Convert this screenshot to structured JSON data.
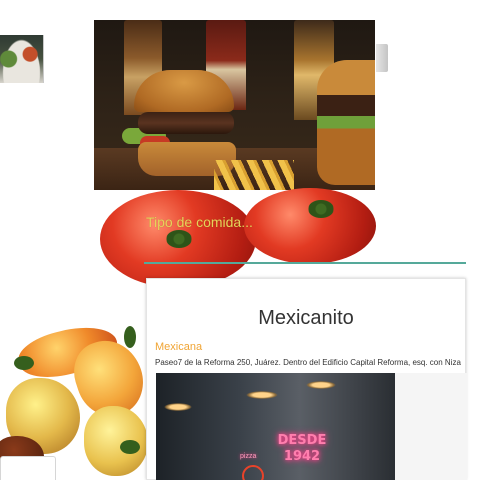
{
  "search": {
    "placeholder": "Tipo de comida..."
  },
  "restaurant_card": {
    "name": "Mexicanito",
    "category": "Mexicana",
    "address": "Paseo7 de la Reforma 250, Juárez. Dentro del Edificio Capital Reforma, esq. con Niza.",
    "photo_sign_lines": [
      "DESDE",
      "1942"
    ],
    "photo_small_sign": "pizza"
  },
  "colors": {
    "placeholder": "#e6d25a",
    "underline_accent": "#55a99a",
    "category": "#f0a433",
    "name_text": "#333333"
  }
}
